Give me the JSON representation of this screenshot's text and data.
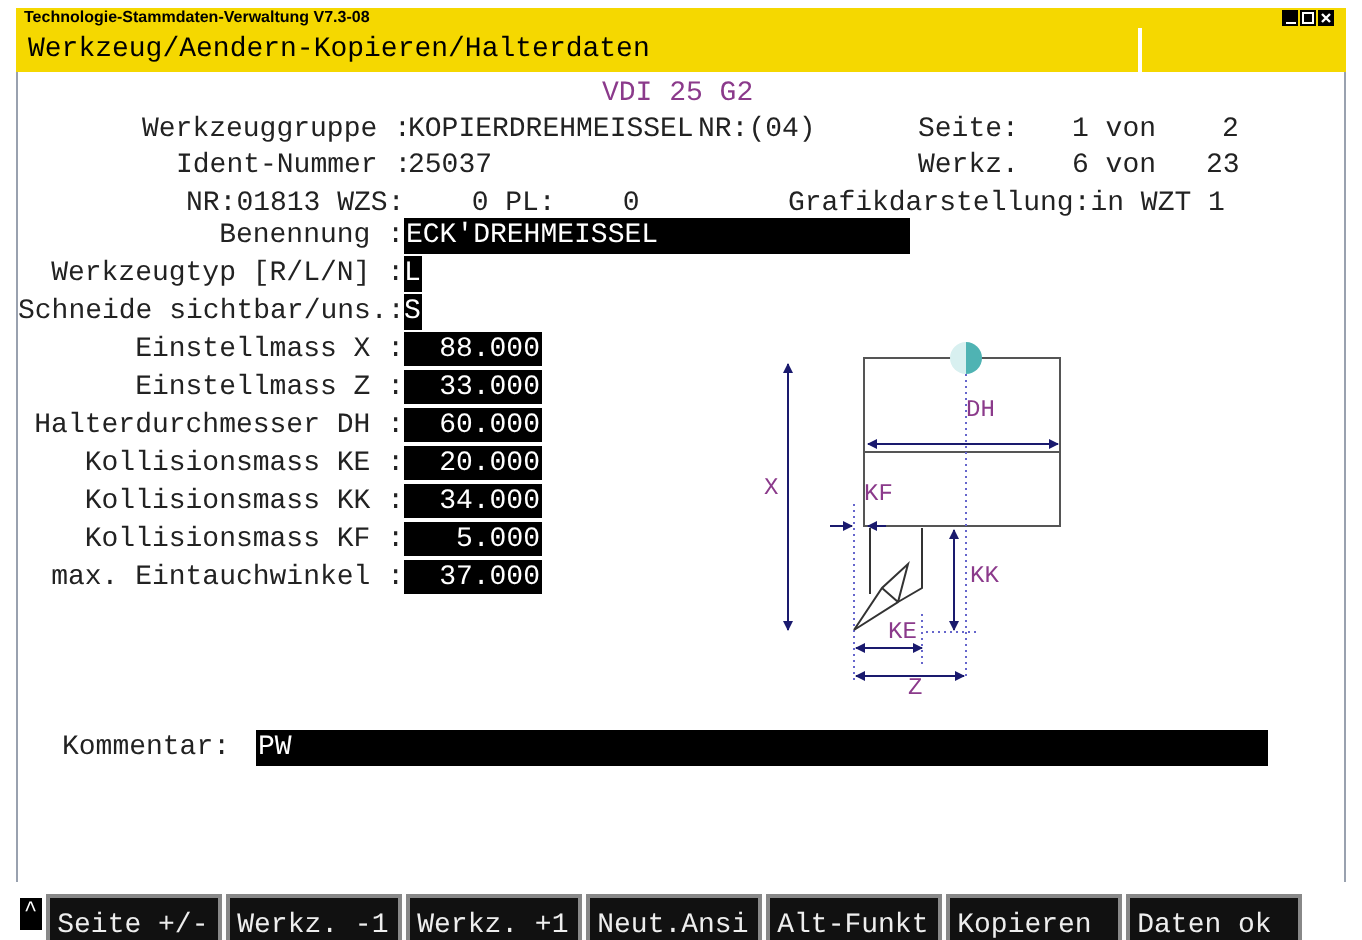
{
  "window": {
    "title": "Technologie-Stammdaten-Verwaltung V7.3-08"
  },
  "header": {
    "title": "Werkzeug/Aendern-Kopieren/Halterdaten"
  },
  "subtitle": "VDI 25 G2",
  "info": {
    "group_label": "Werkzeuggruppe :",
    "group_value": "KOPIERDREHMEISSEL",
    "nr": "NR:(04)",
    "page_label": "Seite:",
    "page_value": "1 von",
    "page_total": "2",
    "ident_label": "Ident-Nummer :",
    "ident_value": "25037",
    "tool_label": "Werkz.",
    "tool_value": "6 von",
    "tool_total": "23",
    "nr_line": "NR:01813 WZS:    0 PL:    0",
    "graphic": "Grafikdarstellung:in WZT 1"
  },
  "fields": [
    {
      "label": "Benennung :",
      "value": "ECK'DREHMEISSEL",
      "kind": "text"
    },
    {
      "label": "Werkzeugtyp [R/L/N] :",
      "value": "L",
      "kind": "char"
    },
    {
      "label": "Schneide sichtbar/uns.:",
      "value": "S",
      "kind": "char"
    },
    {
      "label": "Einstellmass X :",
      "value": "88.000",
      "kind": "number"
    },
    {
      "label": "Einstellmass Z :",
      "value": "33.000",
      "kind": "number"
    },
    {
      "label": "Halterdurchmesser DH :",
      "value": "60.000",
      "kind": "number"
    },
    {
      "label": "Kollisionsmass KE :",
      "value": "20.000",
      "kind": "number"
    },
    {
      "label": "Kollisionsmass KK :",
      "value": "34.000",
      "kind": "number"
    },
    {
      "label": "Kollisionsmass KF :",
      "value": "5.000",
      "kind": "number"
    },
    {
      "label": "max. Eintauchwinkel :",
      "value": "37.000",
      "kind": "number"
    }
  ],
  "diagram": {
    "labels": [
      "DH",
      "X",
      "KF",
      "KK",
      "KE",
      "Z"
    ]
  },
  "comment": {
    "label": "Kommentar:",
    "value": "PW"
  },
  "scroll_caret": "^",
  "buttons": [
    "Seite +/-",
    "Werkz. -1",
    "Werkz. +1",
    "Neut.Ansi",
    "Alt-Funkt",
    "Kopieren",
    "Daten ok"
  ]
}
